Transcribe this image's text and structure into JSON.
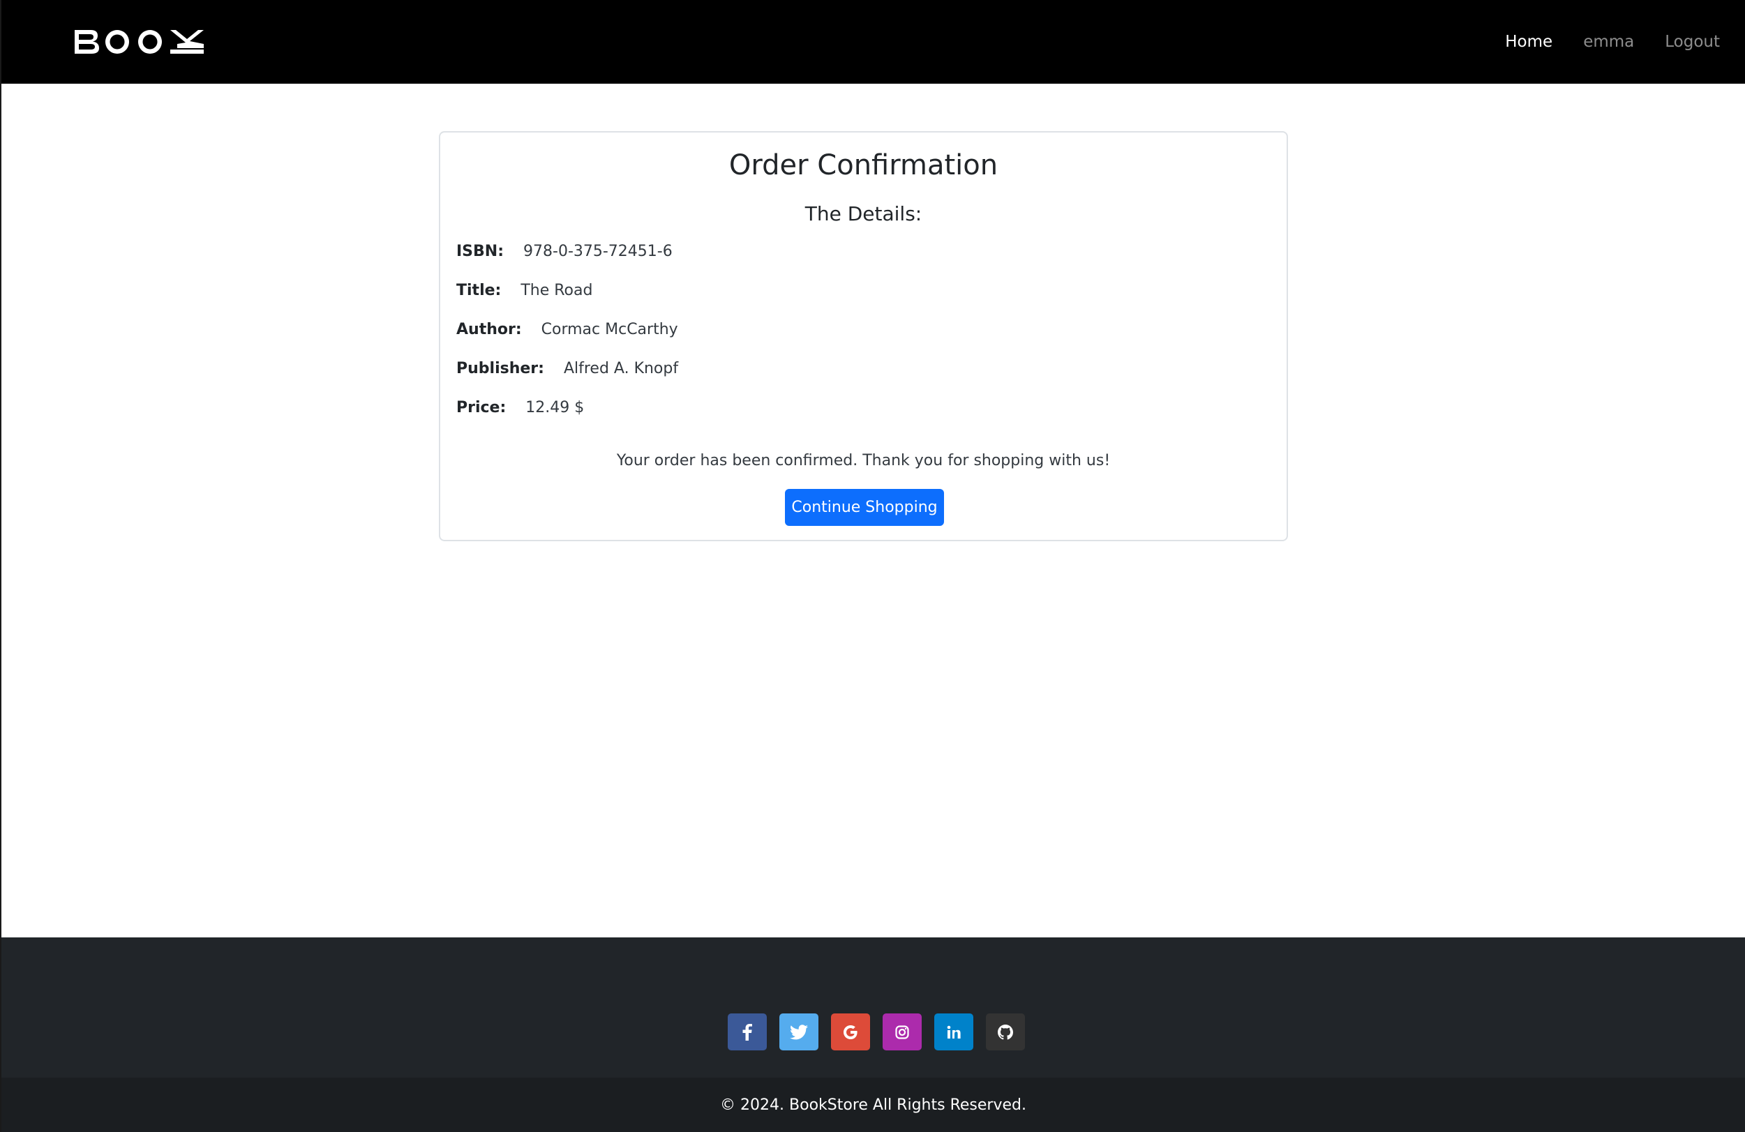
{
  "navbar": {
    "brand": "BOOK",
    "links": [
      {
        "label": "Home",
        "active": true
      },
      {
        "label": "emma",
        "active": false
      },
      {
        "label": "Logout",
        "active": false
      }
    ]
  },
  "card": {
    "title": "Order Confirmation",
    "subtitle": "The Details:",
    "details": [
      {
        "label": "ISBN:",
        "value": "978-0-375-72451-6"
      },
      {
        "label": "Title:",
        "value": "The Road"
      },
      {
        "label": "Author:",
        "value": "Cormac McCarthy"
      },
      {
        "label": "Publisher:",
        "value": "Alfred A. Knopf"
      },
      {
        "label": "Price:",
        "value": "12.49 $"
      }
    ],
    "confirmation_text": "Your order has been confirmed. Thank you for shopping with us!",
    "continue_button": "Continue Shopping"
  },
  "footer": {
    "social": [
      {
        "icon": "facebook-icon",
        "glyph": "f",
        "color": "#3b5998"
      },
      {
        "icon": "twitter-icon",
        "glyph": "🐦",
        "color": "#55acee"
      },
      {
        "icon": "google-icon",
        "glyph": "G",
        "color": "#dd4b39"
      },
      {
        "icon": "instagram-icon",
        "glyph": "◎",
        "color": "#ac2bac"
      },
      {
        "icon": "linkedin-icon",
        "glyph": "in",
        "color": "#0082ca"
      },
      {
        "icon": "github-icon",
        "glyph": "●",
        "color": "#333333"
      }
    ],
    "copyright": "© 2024. BookStore All Rights Reserved."
  },
  "colors": {
    "primary": "#0d6efd",
    "navbar_bg": "#000000",
    "footer_bg": "#212529"
  }
}
